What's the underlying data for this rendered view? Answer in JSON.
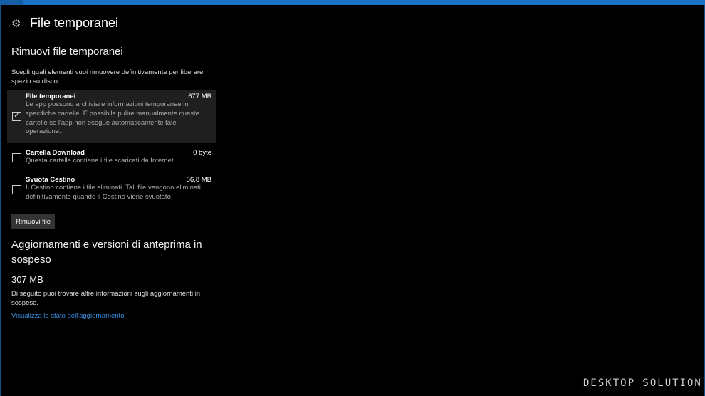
{
  "header": {
    "title": "File temporanei",
    "icon": "gear-icon"
  },
  "section1": {
    "title": "Rimuovi file temporanei",
    "description": "Scegli quali elementi vuoi rimuovere definitivamente per liberare spazio su disco."
  },
  "items": [
    {
      "title": "File temporanei",
      "size": "677 MB",
      "checked": true,
      "description": "Le app possono archiviare informazioni temporanee in specifiche cartelle. È possibile pulire manualmente queste cartelle se l'app non esegue automaticamente tale operazione."
    },
    {
      "title": "Cartella Download",
      "size": "0 byte",
      "checked": false,
      "description": "Questa cartella contiene i file scaricati da Internet."
    },
    {
      "title": "Svuota Cestino",
      "size": "56,8 MB",
      "checked": false,
      "description": "Il Cestino contiene i file eliminati. Tali file vengono eliminati definitivamente quando il Cestino viene svuotato."
    }
  ],
  "remove_button": "Rimuovi file",
  "section2": {
    "title": "Aggiornamenti e versioni di anteprima in sospeso",
    "size": "307 MB",
    "description": "Di seguito puoi trovare altre informazioni sugli aggiornamenti in sospeso.",
    "link": "Visualizza lo stato dell'aggiornamento"
  },
  "watermark": "DESKTOP SOLUTION"
}
